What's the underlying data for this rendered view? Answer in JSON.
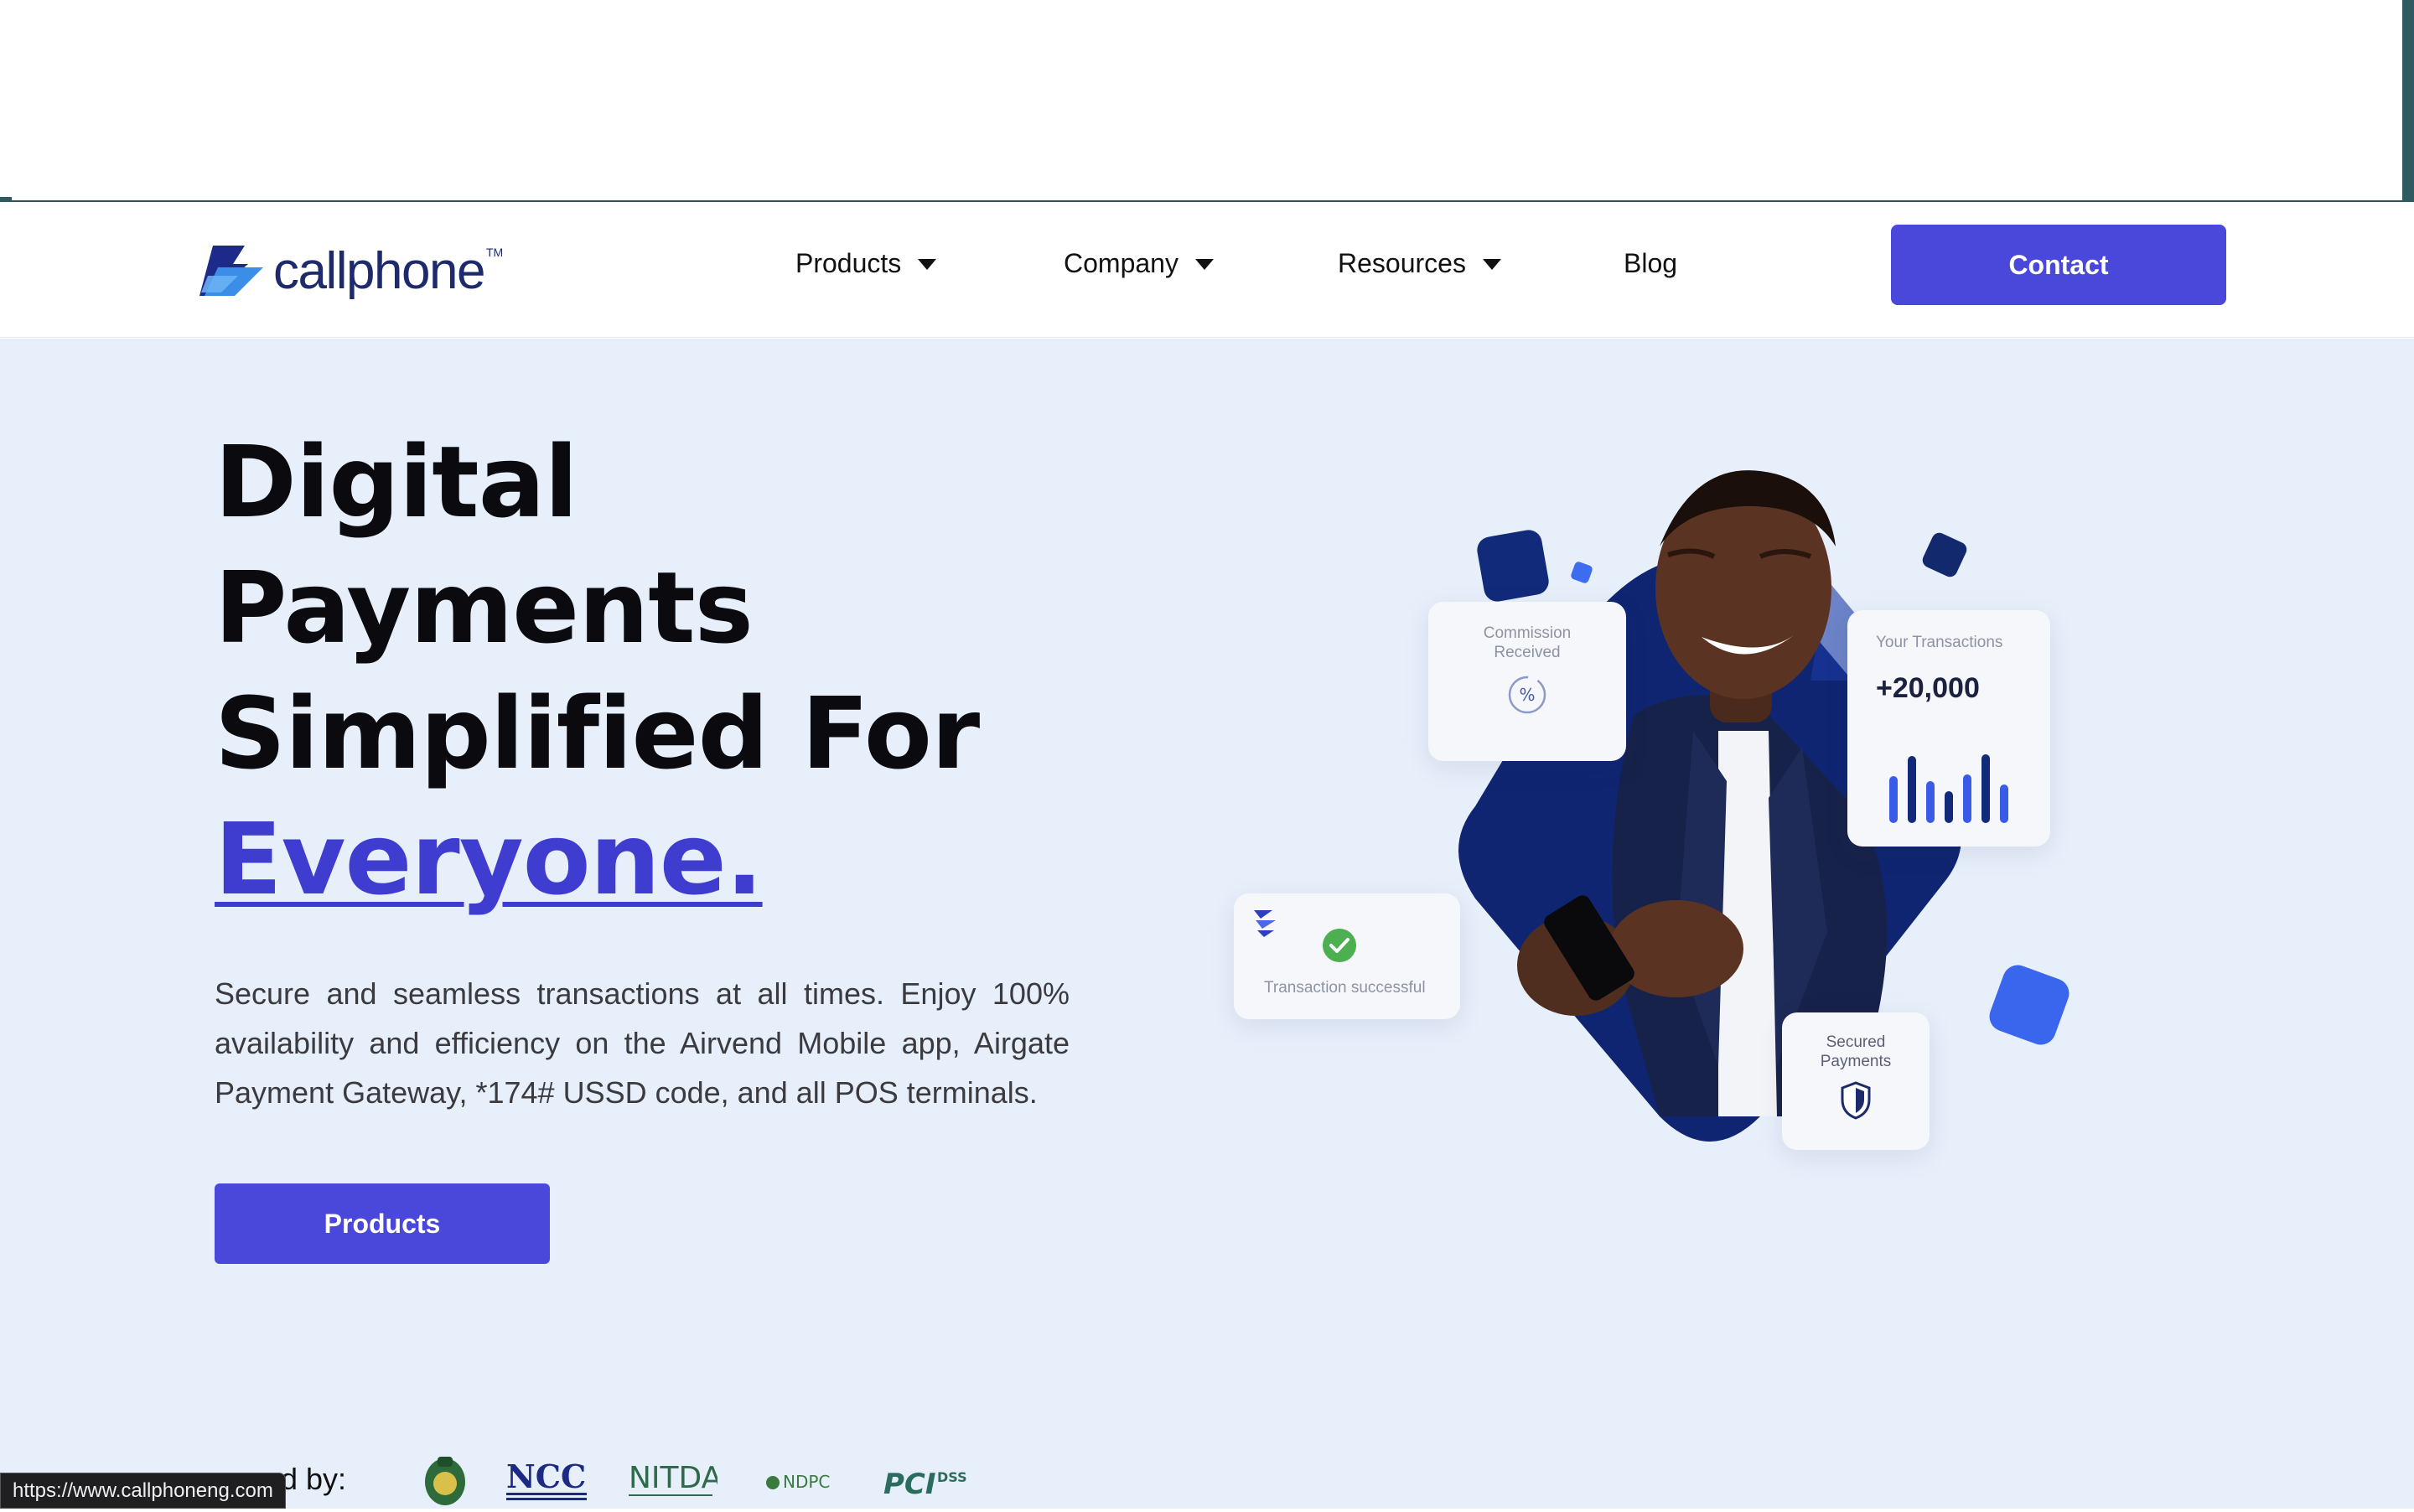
{
  "navbar": {
    "logo_text": "callphone",
    "logo_tm": "TM",
    "links": [
      {
        "label": "Products",
        "has_caret": true
      },
      {
        "label": "Company",
        "has_caret": true
      },
      {
        "label": "Resources",
        "has_caret": true
      },
      {
        "label": "Blog",
        "has_caret": false
      }
    ],
    "contact_label": "Contact"
  },
  "hero": {
    "headline_lines": [
      "Digital",
      "Payments",
      "Simplified For"
    ],
    "headline_accent": "Everyone.",
    "subtext": "Secure and seamless transactions at all times. Enjoy 100% availability and efficiency on the Airvend Mobile app, Airgate Payment Gateway, *174# USSD code, and all POS terminals.",
    "cta_label": "Products"
  },
  "illustration": {
    "commission_card": "Commission Received",
    "transactions_card_title": "Your Transactions",
    "transactions_card_value": "+20,000",
    "transaction_success": "Transaction successful",
    "secured_card": "Secured Payments"
  },
  "regulated": {
    "label": "d by:",
    "logos": [
      "cbn-seal",
      "NCC",
      "NITDA",
      "NDPC",
      "PCI DSS"
    ]
  },
  "status_bar": {
    "url": "https://www.callphoneng.com"
  },
  "colors": {
    "accent": "#4a47db",
    "hero_bg": "#e7effb",
    "navy": "#1d2a6b"
  }
}
